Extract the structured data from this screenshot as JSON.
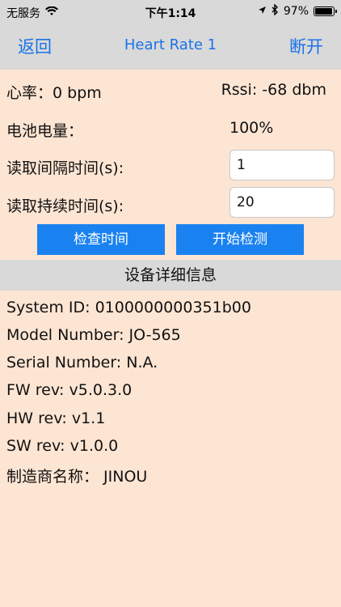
{
  "status_bar": {
    "carrier": "无服务",
    "time": "下午1:14",
    "battery_percent": "97%",
    "battery_level": 0.97,
    "icons": [
      "wifi-icon",
      "location-icon",
      "bluetooth-icon",
      "battery-icon"
    ]
  },
  "nav": {
    "back_label": "返回",
    "title": "Heart Rate 1",
    "action_label": "断开"
  },
  "readings": {
    "heart_rate_label": "心率：",
    "heart_rate_value": "0 bpm",
    "rssi_label": "Rssi:",
    "rssi_value": "-68 dbm",
    "battery_label": "电池电量：",
    "battery_value": "100%"
  },
  "settings": {
    "interval_label": "读取间隔时间(s):",
    "interval_value": "1",
    "duration_label": "读取持续时间(s):",
    "duration_value": "20"
  },
  "buttons": {
    "check_time": "检查时间",
    "start_detect": "开始检测"
  },
  "device_info": {
    "header": "设备详细信息",
    "items": [
      "System ID: 0100000000351b00",
      "Model Number: JO-565",
      "Serial Number: N.A.",
      "FW rev: v5.0.3.0",
      "HW rev: v1.1",
      "SW rev: v1.0.0",
      "制造商名称： JINOU"
    ]
  },
  "colors": {
    "accent": "#1a73e8",
    "button_bg": "#1a82f0",
    "background": "#fde5d3",
    "header_bg": "#d9d9d9"
  }
}
